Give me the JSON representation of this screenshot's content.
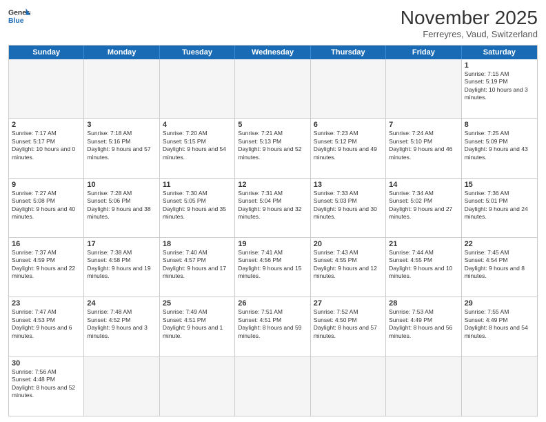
{
  "header": {
    "logo_general": "General",
    "logo_blue": "Blue",
    "month_title": "November 2025",
    "subtitle": "Ferreyres, Vaud, Switzerland"
  },
  "days_of_week": [
    "Sunday",
    "Monday",
    "Tuesday",
    "Wednesday",
    "Thursday",
    "Friday",
    "Saturday"
  ],
  "weeks": [
    {
      "cells": [
        {
          "day": "",
          "info": ""
        },
        {
          "day": "",
          "info": ""
        },
        {
          "day": "",
          "info": ""
        },
        {
          "day": "",
          "info": ""
        },
        {
          "day": "",
          "info": ""
        },
        {
          "day": "",
          "info": ""
        },
        {
          "day": "1",
          "info": "Sunrise: 7:15 AM\nSunset: 5:19 PM\nDaylight: 10 hours and 3 minutes."
        }
      ]
    },
    {
      "cells": [
        {
          "day": "2",
          "info": "Sunrise: 7:17 AM\nSunset: 5:17 PM\nDaylight: 10 hours and 0 minutes."
        },
        {
          "day": "3",
          "info": "Sunrise: 7:18 AM\nSunset: 5:16 PM\nDaylight: 9 hours and 57 minutes."
        },
        {
          "day": "4",
          "info": "Sunrise: 7:20 AM\nSunset: 5:15 PM\nDaylight: 9 hours and 54 minutes."
        },
        {
          "day": "5",
          "info": "Sunrise: 7:21 AM\nSunset: 5:13 PM\nDaylight: 9 hours and 52 minutes."
        },
        {
          "day": "6",
          "info": "Sunrise: 7:23 AM\nSunset: 5:12 PM\nDaylight: 9 hours and 49 minutes."
        },
        {
          "day": "7",
          "info": "Sunrise: 7:24 AM\nSunset: 5:10 PM\nDaylight: 9 hours and 46 minutes."
        },
        {
          "day": "8",
          "info": "Sunrise: 7:25 AM\nSunset: 5:09 PM\nDaylight: 9 hours and 43 minutes."
        }
      ]
    },
    {
      "cells": [
        {
          "day": "9",
          "info": "Sunrise: 7:27 AM\nSunset: 5:08 PM\nDaylight: 9 hours and 40 minutes."
        },
        {
          "day": "10",
          "info": "Sunrise: 7:28 AM\nSunset: 5:06 PM\nDaylight: 9 hours and 38 minutes."
        },
        {
          "day": "11",
          "info": "Sunrise: 7:30 AM\nSunset: 5:05 PM\nDaylight: 9 hours and 35 minutes."
        },
        {
          "day": "12",
          "info": "Sunrise: 7:31 AM\nSunset: 5:04 PM\nDaylight: 9 hours and 32 minutes."
        },
        {
          "day": "13",
          "info": "Sunrise: 7:33 AM\nSunset: 5:03 PM\nDaylight: 9 hours and 30 minutes."
        },
        {
          "day": "14",
          "info": "Sunrise: 7:34 AM\nSunset: 5:02 PM\nDaylight: 9 hours and 27 minutes."
        },
        {
          "day": "15",
          "info": "Sunrise: 7:36 AM\nSunset: 5:01 PM\nDaylight: 9 hours and 24 minutes."
        }
      ]
    },
    {
      "cells": [
        {
          "day": "16",
          "info": "Sunrise: 7:37 AM\nSunset: 4:59 PM\nDaylight: 9 hours and 22 minutes."
        },
        {
          "day": "17",
          "info": "Sunrise: 7:38 AM\nSunset: 4:58 PM\nDaylight: 9 hours and 19 minutes."
        },
        {
          "day": "18",
          "info": "Sunrise: 7:40 AM\nSunset: 4:57 PM\nDaylight: 9 hours and 17 minutes."
        },
        {
          "day": "19",
          "info": "Sunrise: 7:41 AM\nSunset: 4:56 PM\nDaylight: 9 hours and 15 minutes."
        },
        {
          "day": "20",
          "info": "Sunrise: 7:43 AM\nSunset: 4:55 PM\nDaylight: 9 hours and 12 minutes."
        },
        {
          "day": "21",
          "info": "Sunrise: 7:44 AM\nSunset: 4:55 PM\nDaylight: 9 hours and 10 minutes."
        },
        {
          "day": "22",
          "info": "Sunrise: 7:45 AM\nSunset: 4:54 PM\nDaylight: 9 hours and 8 minutes."
        }
      ]
    },
    {
      "cells": [
        {
          "day": "23",
          "info": "Sunrise: 7:47 AM\nSunset: 4:53 PM\nDaylight: 9 hours and 6 minutes."
        },
        {
          "day": "24",
          "info": "Sunrise: 7:48 AM\nSunset: 4:52 PM\nDaylight: 9 hours and 3 minutes."
        },
        {
          "day": "25",
          "info": "Sunrise: 7:49 AM\nSunset: 4:51 PM\nDaylight: 9 hours and 1 minute."
        },
        {
          "day": "26",
          "info": "Sunrise: 7:51 AM\nSunset: 4:51 PM\nDaylight: 8 hours and 59 minutes."
        },
        {
          "day": "27",
          "info": "Sunrise: 7:52 AM\nSunset: 4:50 PM\nDaylight: 8 hours and 57 minutes."
        },
        {
          "day": "28",
          "info": "Sunrise: 7:53 AM\nSunset: 4:49 PM\nDaylight: 8 hours and 56 minutes."
        },
        {
          "day": "29",
          "info": "Sunrise: 7:55 AM\nSunset: 4:49 PM\nDaylight: 8 hours and 54 minutes."
        }
      ]
    },
    {
      "cells": [
        {
          "day": "30",
          "info": "Sunrise: 7:56 AM\nSunset: 4:48 PM\nDaylight: 8 hours and 52 minutes."
        },
        {
          "day": "",
          "info": ""
        },
        {
          "day": "",
          "info": ""
        },
        {
          "day": "",
          "info": ""
        },
        {
          "day": "",
          "info": ""
        },
        {
          "day": "",
          "info": ""
        },
        {
          "day": "",
          "info": ""
        }
      ]
    }
  ]
}
